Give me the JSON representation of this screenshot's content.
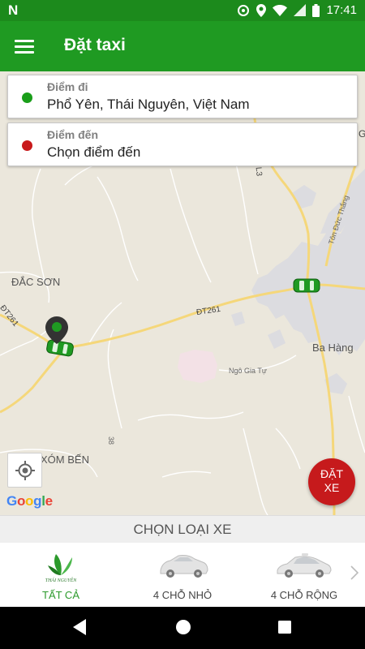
{
  "status_bar": {
    "left_icon": "N",
    "time": "17:41",
    "icons": [
      "sync-icon",
      "location-icon",
      "wifi-icon",
      "signal-icon",
      "battery-icon"
    ]
  },
  "app_bar": {
    "title": "Đặt taxi",
    "menu_icon": "menu-icon"
  },
  "pickup": {
    "label": "Điểm đi",
    "value": "Phổ Yên, Thái Nguyên, Việt Nam",
    "dot_color": "#1a9e1a"
  },
  "destination": {
    "label": "Điểm đến",
    "value": "Chọn điểm đến",
    "dot_color": "#c8191b"
  },
  "map": {
    "labels": {
      "dac_son": "ĐẮC SƠN",
      "dt261": "ĐT261",
      "ba_hang": "Ba Hàng",
      "ngo_gia_tu": "Ngô Gia Tự",
      "ton_duc_thang": "Tôn Đức Thắng",
      "xom_ben": "XÓM BẾN",
      "road_38": "38",
      "dt261_left": "ĐT261",
      "road_3": "L3",
      "edge_g": "G"
    },
    "google": [
      "G",
      "o",
      "o",
      "g",
      "l",
      "e"
    ],
    "google_colors": [
      "#4285f4",
      "#ea4335",
      "#fbbc05",
      "#4285f4",
      "#34a853",
      "#ea4335"
    ]
  },
  "book_button": {
    "line1": "ĐẶT",
    "line2": "XE"
  },
  "car_section": {
    "title": "CHỌN LOẠI XE",
    "items": [
      {
        "label": "TẤT CẢ",
        "active": true
      },
      {
        "label": "4 CHỖ NHỎ",
        "active": false
      },
      {
        "label": "4 CHỖ RỘNG",
        "active": false
      }
    ],
    "logo_text": "THÁI NGUYÊN"
  },
  "colors": {
    "primary": "#1f9a22",
    "accent_red": "#c61a1c",
    "active_tab": "#2c9a2c"
  }
}
